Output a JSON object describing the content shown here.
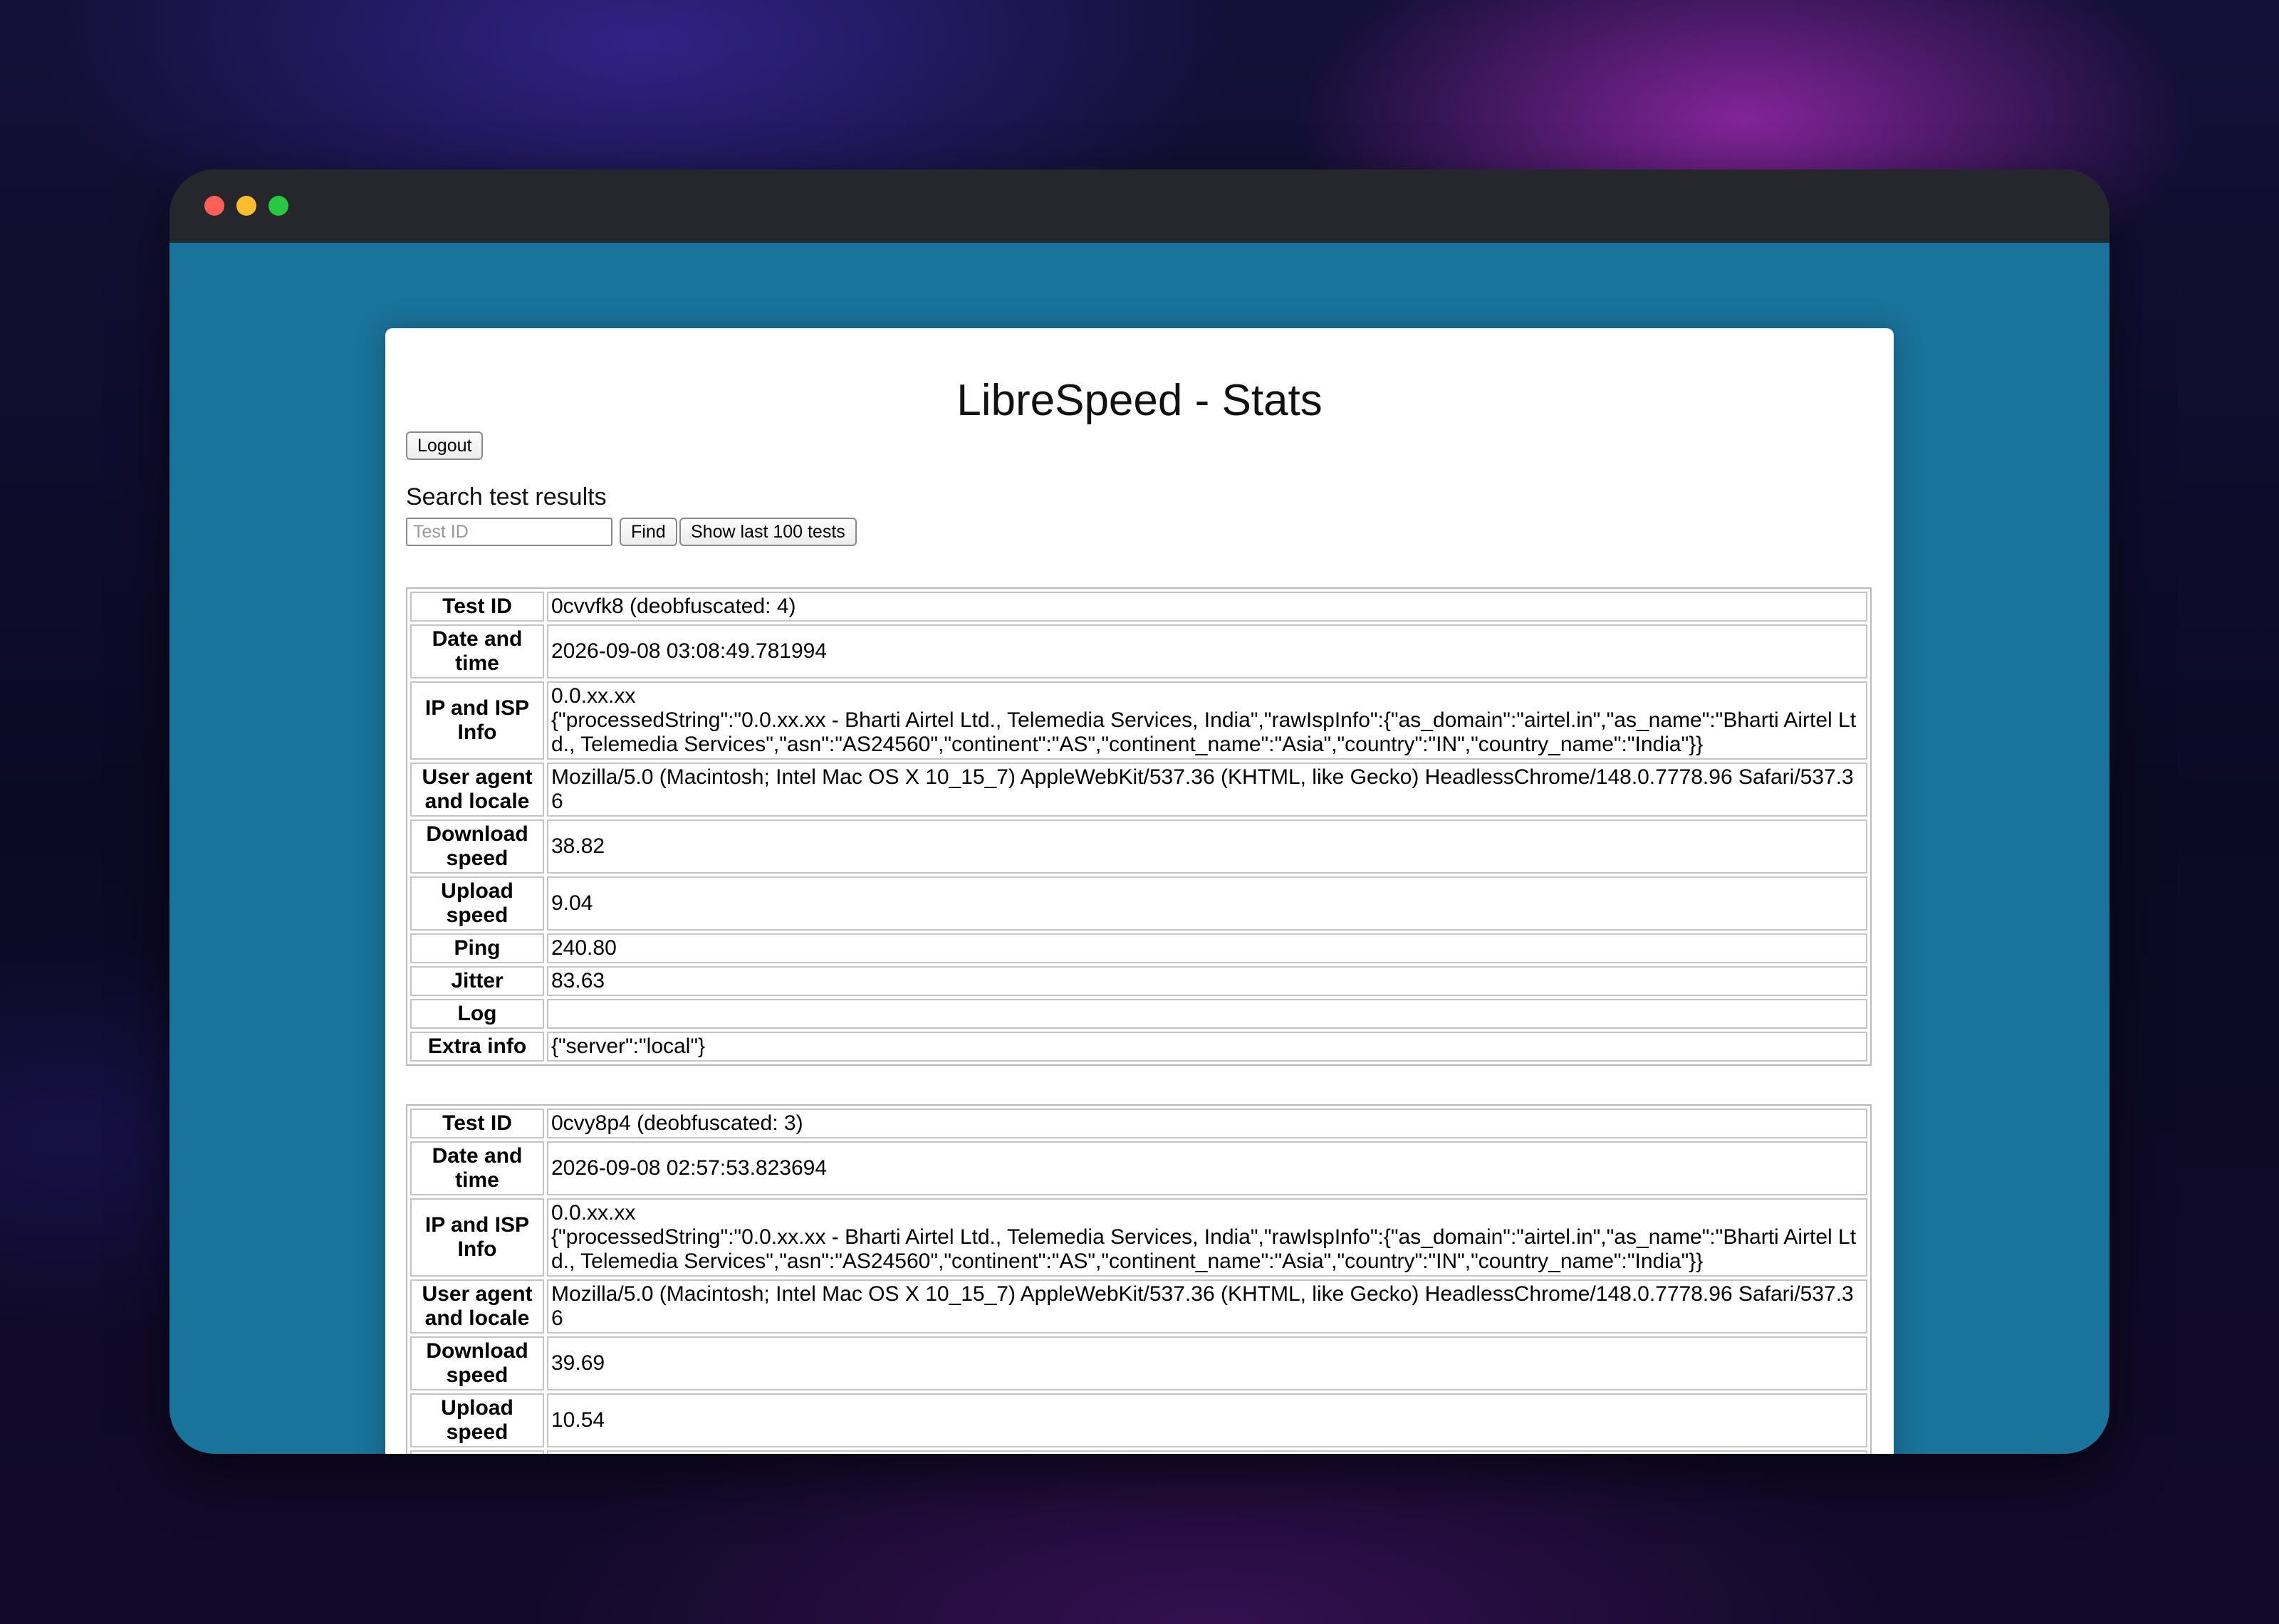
{
  "window": {
    "controls": [
      "close",
      "minimize",
      "maximize"
    ]
  },
  "page": {
    "title": "LibreSpeed - Stats",
    "logout_label": "Logout",
    "search_label": "Search test results",
    "search_placeholder": "Test ID",
    "find_label": "Find",
    "show_last_label": "Show last 100 tests"
  },
  "labels": {
    "test_id": "Test ID",
    "date_time": "Date and time",
    "ip_isp": "IP and ISP Info",
    "user_agent": "User agent and locale",
    "download": "Download speed",
    "upload": "Upload speed",
    "ping": "Ping",
    "jitter": "Jitter",
    "log": "Log",
    "extra": "Extra info"
  },
  "tests": [
    {
      "test_id": "0cvvfk8 (deobfuscated: 4)",
      "date_time": "2026-09-08 03:08:49.781994",
      "ip": "0.0.xx.xx",
      "isp_info": "{\"processedString\":\"0.0.xx.xx - Bharti Airtel Ltd., Telemedia Services, India\",\"rawIspInfo\":{\"as_domain\":\"airtel.in\",\"as_name\":\"Bharti Airtel Ltd., Telemedia Services\",\"asn\":\"AS24560\",\"continent\":\"AS\",\"continent_name\":\"Asia\",\"country\":\"IN\",\"country_name\":\"India\"}}",
      "user_agent": "Mozilla/5.0 (Macintosh; Intel Mac OS X 10_15_7) AppleWebKit/537.36 (KHTML, like Gecko) HeadlessChrome/148.0.7778.96 Safari/537.36",
      "download": "38.82",
      "upload": "9.04",
      "ping": "240.80",
      "jitter": "83.63",
      "log": "",
      "extra": "{\"server\":\"local\"}"
    },
    {
      "test_id": "0cvy8p4 (deobfuscated: 3)",
      "date_time": "2026-09-08 02:57:53.823694",
      "ip": "0.0.xx.xx",
      "isp_info": "{\"processedString\":\"0.0.xx.xx - Bharti Airtel Ltd., Telemedia Services, India\",\"rawIspInfo\":{\"as_domain\":\"airtel.in\",\"as_name\":\"Bharti Airtel Ltd., Telemedia Services\",\"asn\":\"AS24560\",\"continent\":\"AS\",\"continent_name\":\"Asia\",\"country\":\"IN\",\"country_name\":\"India\"}}",
      "user_agent": "Mozilla/5.0 (Macintosh; Intel Mac OS X 10_15_7) AppleWebKit/537.36 (KHTML, like Gecko) HeadlessChrome/148.0.7778.96 Safari/537.36",
      "download": "39.69",
      "upload": "10.54"
    }
  ]
}
